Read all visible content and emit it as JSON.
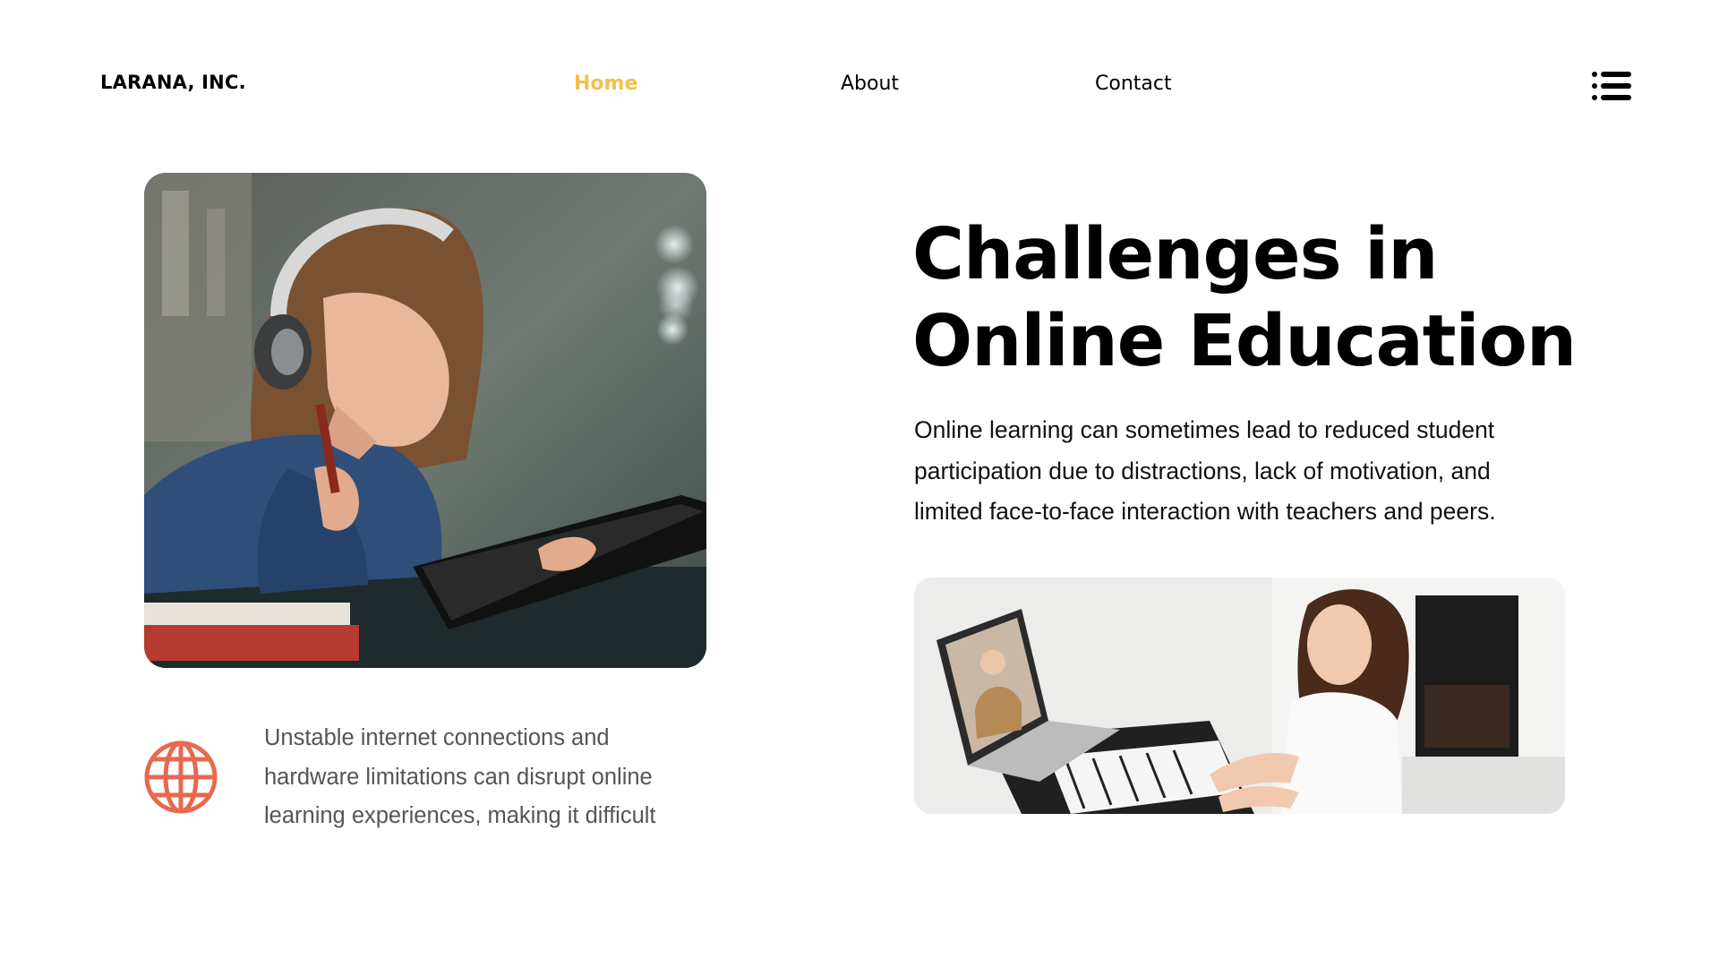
{
  "header": {
    "brand": "LARANA, INC.",
    "nav": [
      {
        "label": "Home",
        "active": true
      },
      {
        "label": "About",
        "active": false
      },
      {
        "label": "Contact",
        "active": false
      }
    ],
    "menu_icon": "list-menu-icon"
  },
  "hero": {
    "title_line1": "Challenges in",
    "title_line2": "Online Education",
    "lead": "Online learning can sometimes lead to reduced student participation due to distractions, lack of motivation, and limited face-to-face interaction with teachers and peers."
  },
  "feature": {
    "icon": "globe-icon",
    "text": "Unstable internet connections and hardware limitations can disrupt online learning experiences, making it difficult"
  },
  "colors": {
    "accent_nav": "#f2c14e",
    "globe": "#e8694e",
    "text_muted": "#555555"
  }
}
